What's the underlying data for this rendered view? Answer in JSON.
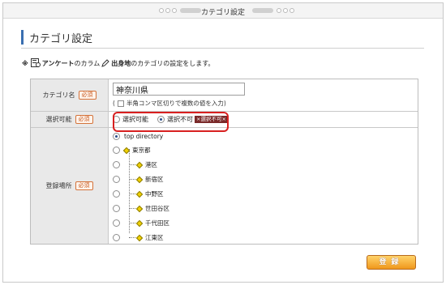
{
  "window": {
    "title": "カテゴリ設定"
  },
  "page": {
    "heading": "カテゴリ設定"
  },
  "description": {
    "mark": "※",
    "part1": "アンケート",
    "part2": "のカラム",
    "part3": "出身地",
    "part4": "のカテゴリの設定をします。"
  },
  "form": {
    "required_label": "必須",
    "category_name": {
      "label": "カテゴリ名",
      "value": "神奈川県",
      "checkbox_prefix": "(",
      "checkbox_label": "半角コンマ区切りで複数の値を入力)"
    },
    "selectable": {
      "label": "選択可能",
      "options": [
        "選択可能",
        "選択不可"
      ],
      "selected": "選択不可",
      "tag": "×選択不可×"
    },
    "location": {
      "label": "登録場所",
      "items": [
        "top directory",
        "東京都",
        "港区",
        "新宿区",
        "中野区",
        "世田谷区",
        "千代田区",
        "江東区"
      ],
      "selected": "top directory"
    }
  },
  "actions": {
    "register_label": "登録"
  }
}
